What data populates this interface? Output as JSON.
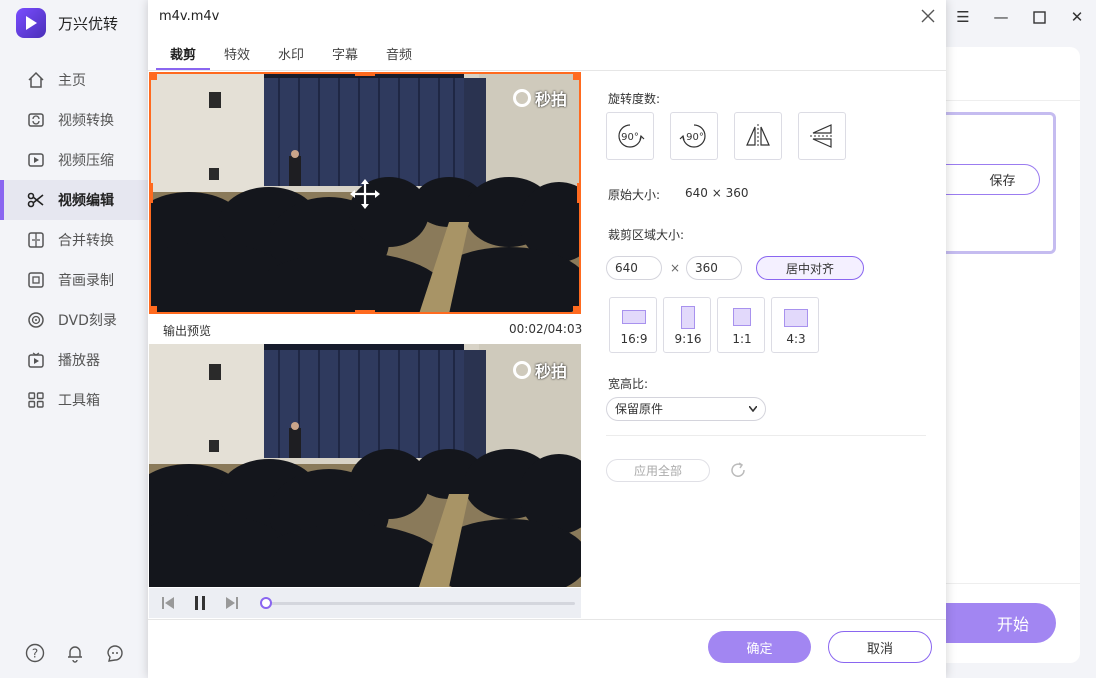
{
  "app": {
    "name": "万兴优转"
  },
  "sidebar": {
    "items": [
      {
        "label": "主页",
        "icon": "home-icon"
      },
      {
        "label": "视频转换",
        "icon": "convert-icon"
      },
      {
        "label": "视频压缩",
        "icon": "compress-icon"
      },
      {
        "label": "视频编辑",
        "icon": "scissors-icon",
        "active": true
      },
      {
        "label": "合并转换",
        "icon": "merge-icon"
      },
      {
        "label": "音画录制",
        "icon": "record-icon"
      },
      {
        "label": "DVD刻录",
        "icon": "dvd-icon"
      },
      {
        "label": "播放器",
        "icon": "player-icon"
      },
      {
        "label": "工具箱",
        "icon": "toolbox-icon"
      }
    ],
    "bottom_icons": [
      "help-icon",
      "bell-icon",
      "feedback-icon"
    ]
  },
  "background": {
    "save_label": "保存",
    "start_label": "开始"
  },
  "dialog": {
    "title": "m4v.m4v",
    "tabs": [
      "裁剪",
      "特效",
      "水印",
      "字幕",
      "音频"
    ],
    "active_tab": "裁剪",
    "preview_label": "输出预览",
    "time": "00:02/04:03",
    "watermark_text": "秒拍",
    "playback_progress": 0.0,
    "rotation": {
      "label": "旋转度数:",
      "buttons": [
        "rotate-cw-90-icon",
        "rotate-ccw-90-icon",
        "flip-horizontal-icon",
        "flip-vertical-icon"
      ],
      "deg_text": "90°"
    },
    "original_size": {
      "label": "原始大小:",
      "value": "640 × 360"
    },
    "crop_size": {
      "label": "裁剪区域大小:",
      "width": "640",
      "times": "×",
      "height": "360",
      "center_label": "居中对齐"
    },
    "ratios": [
      "16:9",
      "9:16",
      "1:1",
      "4:3"
    ],
    "aspect": {
      "label": "宽高比:",
      "selected": "保留原件"
    },
    "apply_all_label": "应用全部",
    "ok_label": "确定",
    "cancel_label": "取消"
  },
  "colors": {
    "accent": "#8a66f0",
    "crop_border": "#ff6a1f",
    "primary_button": "#a286f2"
  }
}
